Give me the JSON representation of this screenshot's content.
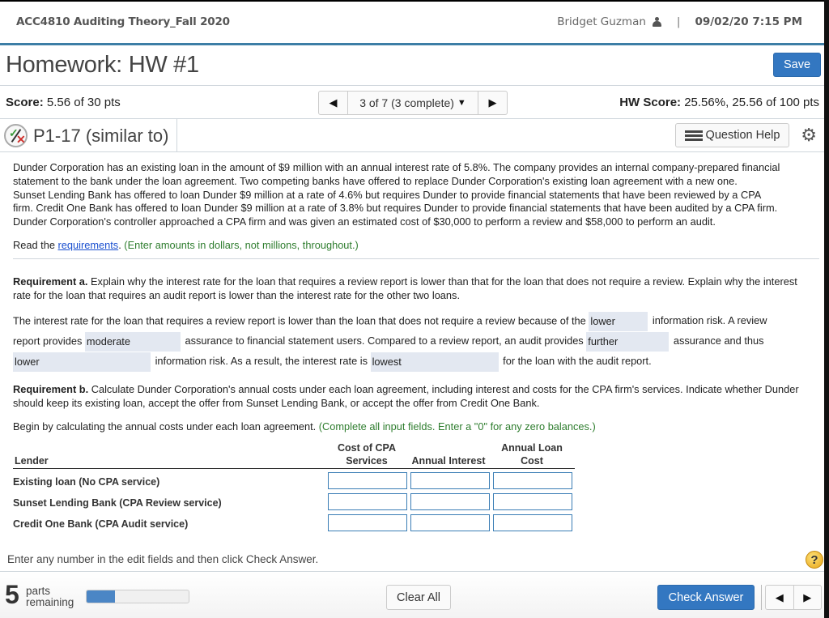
{
  "topbar": {
    "course": "ACC4810 Auditing Theory_Fall 2020",
    "user_name": "Bridget Guzman",
    "separator": "|",
    "datetime": "09/02/20 7:15 PM"
  },
  "header": {
    "title": "Homework: HW #1",
    "save_label": "Save"
  },
  "score_row": {
    "score_label": "Score:",
    "score_value": "5.56 of 30 pts",
    "question_nav": "3 of 7 (3 complete)",
    "hw_score_label": "HW Score:",
    "hw_score_value": "25.56%, 25.56 of 100 pts"
  },
  "question": {
    "title": "P1-17 (similar to)",
    "help_label": "Question Help"
  },
  "problem": {
    "lines": [
      "Dunder Corporation has an existing loan in the amount of $9 million with an annual interest rate of 5.8%. The company provides an internal company-prepared financial",
      "statement to the bank under the loan agreement. Two competing banks have offered to replace Dunder Corporation's existing loan agreement with a new one.",
      "Sunset Lending Bank has offered to loan Dunder $9 million at a rate of 4.6% but requires Dunder to provide financial statements that have been reviewed by a CPA",
      "firm. Credit One Bank has offered to loan Dunder $9 million at a rate of 3.8% but requires Dunder to provide financial statements that have been audited by a CPA firm.",
      "Dunder Corporation's controller approached a CPA firm and was given an estimated cost of $30,000 to perform a review and $58,000 to perform an audit."
    ],
    "read_prefix": "Read the ",
    "read_link": "requirements",
    "read_suffix": ".",
    "read_note": " (Enter amounts in dollars, not millions, throughout.)"
  },
  "req_a": {
    "label": "Requirement a.",
    "text": " Explain why the interest rate for the loan that requires a review report is lower than that for the loan that does not require a review. Explain why the interest rate for the loan that requires an audit report is lower than the interest rate for the other two loans.",
    "line1_a": "The interest rate for the loan that requires a review report is lower than the loan that does not require a review because of the",
    "dd1": "lower",
    "line1_b": "information risk. A review",
    "line2_a": "report provides",
    "dd2": "moderate",
    "line2_b": "assurance to financial statement users. Compared to a review report, an audit provides",
    "dd3": "further",
    "line2_c": "assurance and thus",
    "dd4": "lower",
    "line3_a": "information risk. As a result, the interest rate is",
    "dd5": "lowest",
    "line3_b": "for the loan with the audit report."
  },
  "req_b": {
    "label": "Requirement b.",
    "text": " Calculate Dunder Corporation's annual costs under each loan agreement, including interest and costs for the CPA firm's services. Indicate whether Dunder should keep its existing loan, accept the offer from Sunset Lending Bank, or accept the offer from Credit One Bank.",
    "begin": "Begin by calculating the annual costs under each loan agreement.",
    "begin_note": " (Complete all input fields. Enter a \"0\" for any zero balances.)"
  },
  "table": {
    "headers": {
      "lender": "Lender",
      "cpa_1": "Cost of CPA",
      "cpa_2": "Services",
      "interest": "Annual Interest",
      "loan_1": "Annual Loan",
      "loan_2": "Cost"
    },
    "rows": [
      {
        "lender": "Existing loan (No CPA service)",
        "cpa": "",
        "interest": "",
        "cost": ""
      },
      {
        "lender": "Sunset Lending Bank (CPA Review service)",
        "cpa": "",
        "interest": "",
        "cost": ""
      },
      {
        "lender": "Credit One Bank (CPA Audit service)",
        "cpa": "",
        "interest": "",
        "cost": ""
      }
    ]
  },
  "footer": {
    "hint": "Enter any number in the edit fields and then click Check Answer.",
    "parts_count": "5",
    "parts_label_1": "parts",
    "parts_label_2": "remaining",
    "progress_fraction": 0.28,
    "clear_label": "Clear All",
    "check_label": "Check Answer",
    "help_symbol": "?"
  },
  "colors": {
    "accent": "#3d7ea6",
    "primary_button": "#3377c1",
    "dropdown_fill": "#e3e8f1",
    "note_green": "#2e7d2e",
    "link_blue": "#1a4fcf"
  }
}
